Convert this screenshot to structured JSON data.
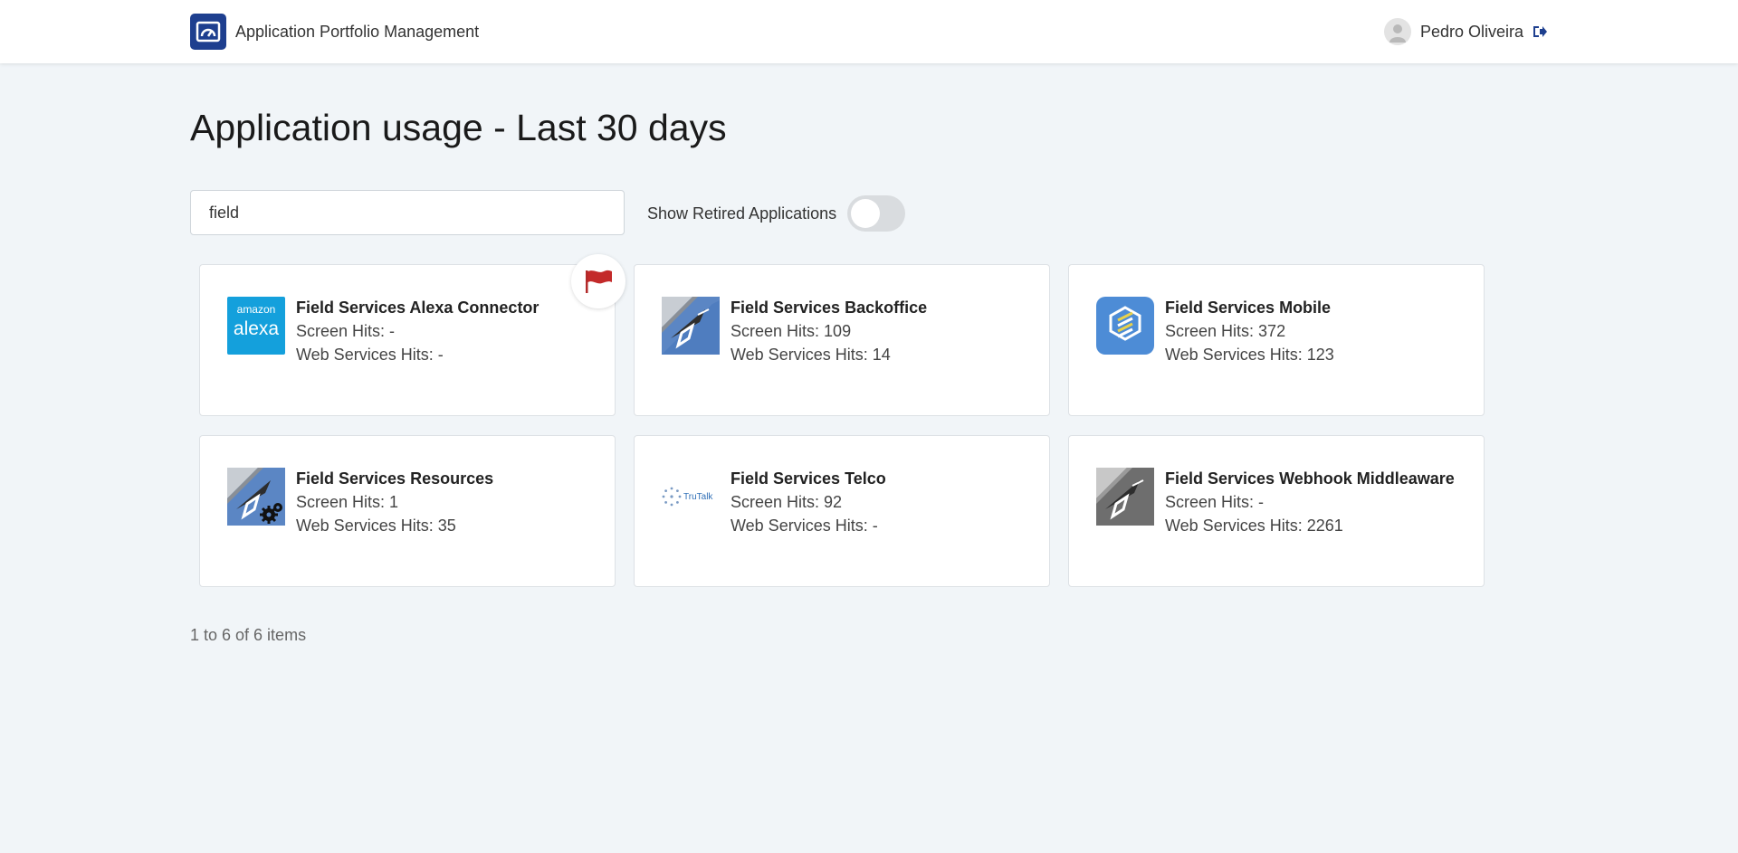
{
  "header": {
    "app_title": "Application Portfolio Management",
    "user_name": "Pedro Oliveira",
    "icons": {
      "brand": "dashboard-gauge-icon",
      "avatar": "user-avatar-icon",
      "logout": "logout-icon"
    },
    "brand_color": "#1e3f8f"
  },
  "page": {
    "title": "Application usage - Last 30 days"
  },
  "filters": {
    "search_value": "field",
    "retired_label": "Show Retired Applications",
    "retired_toggle_on": false
  },
  "cards": [
    {
      "name": "Field Services Alexa Connector",
      "screen_label": "Screen Hits:",
      "screen_value": "-",
      "ws_label": "Web Services Hits:",
      "ws_value": "-",
      "logo": "amazon-alexa-logo",
      "logo_text_top": "amazon",
      "logo_text_main": "alexa",
      "flagged": true,
      "flag_icon": "red-flag-icon"
    },
    {
      "name": "Field Services Backoffice",
      "screen_label": "Screen Hits:",
      "screen_value": "109",
      "ws_label": "Web Services Hits:",
      "ws_value": "14",
      "logo": "pen-logo"
    },
    {
      "name": "Field Services Mobile",
      "screen_label": "Screen Hits:",
      "screen_value": "372",
      "ws_label": "Web Services Hits:",
      "ws_value": "123",
      "logo": "stacked-layers-logo"
    },
    {
      "name": "Field Services Resources",
      "screen_label": "Screen Hits:",
      "screen_value": "1",
      "ws_label": "Web Services Hits:",
      "ws_value": "35",
      "logo": "pen-gears-logo"
    },
    {
      "name": "Field Services Telco",
      "screen_label": "Screen Hits:",
      "screen_value": "92",
      "ws_label": "Web Services Hits:",
      "ws_value": "-",
      "logo": "trutalk-logo",
      "logo_text": "TruTalk"
    },
    {
      "name": "Field Services Webhook Middleaware",
      "screen_label": "Screen Hits:",
      "screen_value": "-",
      "ws_label": "Web Services Hits:",
      "ws_value": "2261",
      "logo": "pen-gray-logo"
    }
  ],
  "pagination": {
    "summary": "1 to 6 of 6 items"
  }
}
